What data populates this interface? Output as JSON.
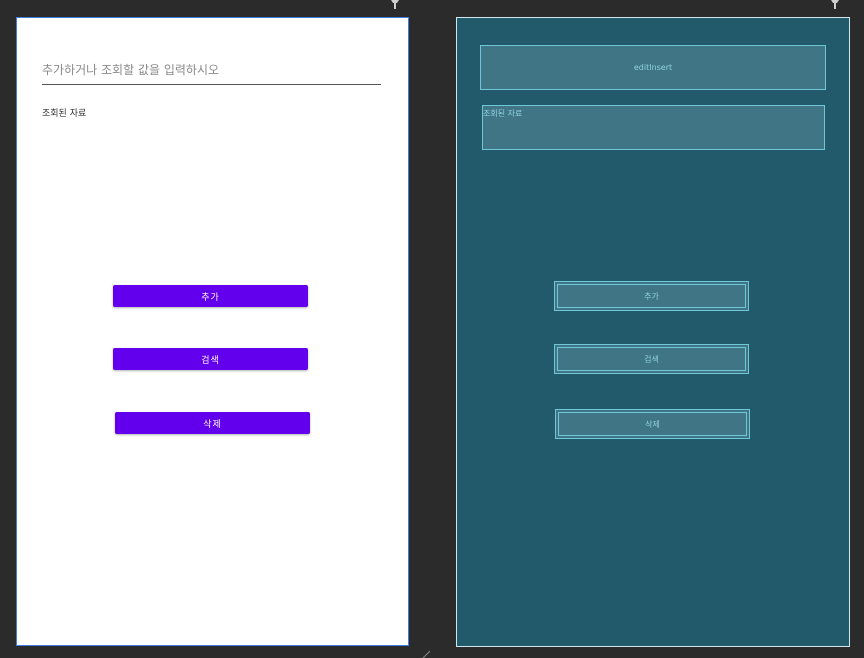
{
  "design_view": {
    "edit_hint": "추가하거나 조회할 값을 입력하시오",
    "result_label": "조회된 자료",
    "buttons": {
      "add": "추가",
      "search": "검색",
      "delete": "삭제"
    },
    "button_color": "#6200ee"
  },
  "blueprint_view": {
    "edit_id": "editInsert",
    "result_label": "조회된 자료",
    "buttons": {
      "add": "추가",
      "search": "검색",
      "delete": "삭제"
    },
    "background_color": "#235a6b"
  },
  "icons": {
    "pin": "pin-icon",
    "resize": "resize-handle-icon"
  }
}
